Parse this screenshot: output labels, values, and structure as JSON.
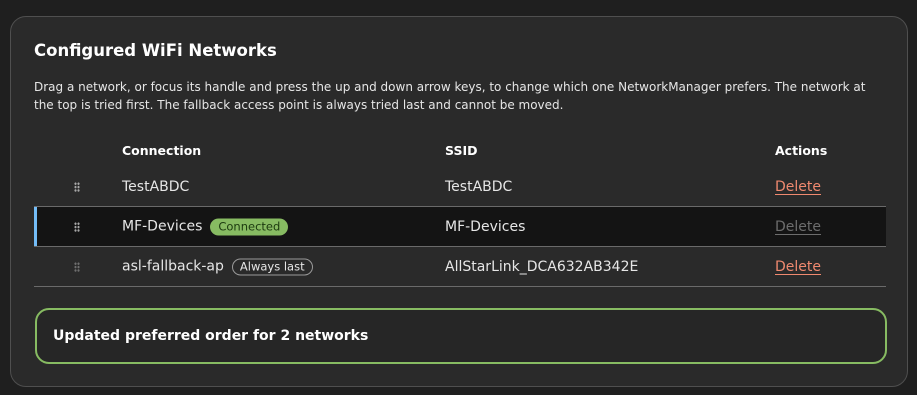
{
  "card": {
    "title": "Configured WiFi Networks",
    "description": "Drag a network, or focus its handle and press the up and down arrow keys, to change which one NetworkManager prefers. The network at the top is tried first. The fallback access point is always tried last and cannot be moved."
  },
  "table": {
    "columns": {
      "connection": "Connection",
      "ssid": "SSID",
      "actions": "Actions"
    },
    "rows": [
      {
        "connection": "TestABDC",
        "badge": "",
        "ssid": "TestABDC",
        "action": "Delete",
        "action_enabled": true,
        "selected": false,
        "draggable": true
      },
      {
        "connection": "MF-Devices",
        "badge": "Connected",
        "ssid": "MF-Devices",
        "action": "Delete",
        "action_enabled": false,
        "selected": true,
        "draggable": true
      },
      {
        "connection": "asl-fallback-ap",
        "badge": "Always last",
        "ssid": "AllStarLink_DCA632AB342E",
        "action": "Delete",
        "action_enabled": true,
        "selected": false,
        "draggable": false
      }
    ]
  },
  "alert": {
    "message": "Updated preferred order for 2 networks",
    "status": "success"
  },
  "colors": {
    "background": "#1f1f1f",
    "card": "#2a2a2a",
    "success": "#87bb62",
    "danger_link": "#f0896f",
    "selected_accent": "#73bcf7"
  },
  "icons": {
    "drag_handle": "grip-vertical-icon"
  }
}
